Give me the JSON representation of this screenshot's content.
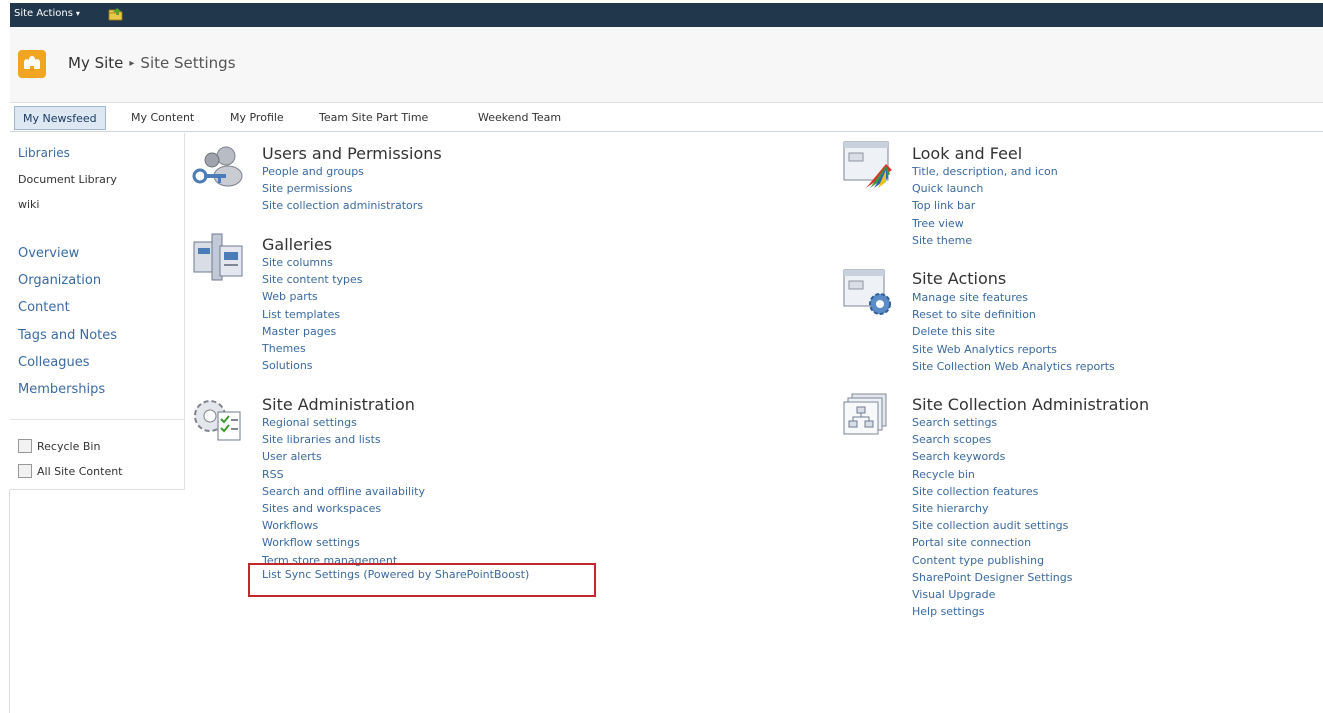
{
  "ribbon": {
    "site_actions": "Site Actions",
    "caret": "▾"
  },
  "breadcrumb": {
    "root": "My Site",
    "separator": "▸",
    "current": "Site Settings"
  },
  "topnav": {
    "tabs": [
      "My Newsfeed",
      "My Content",
      "My Profile",
      "Team Site Part Time",
      "Weekend Team"
    ]
  },
  "leftnav": {
    "libraries_heading": "Libraries",
    "libraries": [
      "Document Library",
      "wiki"
    ],
    "links": [
      "Overview",
      "Organization",
      "Content",
      "Tags and Notes",
      "Colleagues",
      "Memberships"
    ],
    "recycle_bin": "Recycle Bin",
    "all_site_content": "All Site Content"
  },
  "sections": {
    "users": {
      "title": "Users and Permissions",
      "links": [
        "People and groups",
        "Site permissions",
        "Site collection administrators"
      ]
    },
    "galleries": {
      "title": "Galleries",
      "links": [
        "Site columns",
        "Site content types",
        "Web parts",
        "List templates",
        "Master pages",
        "Themes",
        "Solutions"
      ]
    },
    "site_admin": {
      "title": "Site Administration",
      "links": [
        "Regional settings",
        "Site libraries and lists",
        "User alerts",
        "RSS",
        "Search and offline availability",
        "Sites and workspaces",
        "Workflows",
        "Workflow settings",
        "Term store management"
      ],
      "highlighted_link": "List Sync Settings (Powered by SharePointBoost)"
    },
    "look_feel": {
      "title": "Look and Feel",
      "links": [
        "Title, description, and icon",
        "Quick launch",
        "Top link bar",
        "Tree view",
        "Site theme"
      ]
    },
    "site_actions": {
      "title": "Site Actions",
      "links": [
        "Manage site features",
        "Reset to site definition",
        "Delete this site",
        "Site Web Analytics reports",
        "Site Collection Web Analytics reports"
      ]
    },
    "site_collection_admin": {
      "title": "Site Collection Administration",
      "links": [
        "Search settings",
        "Search scopes",
        "Search keywords",
        "Recycle bin",
        "Site collection features",
        "Site hierarchy",
        "Site collection audit settings",
        "Portal site connection",
        "Content type publishing",
        "SharePoint Designer Settings",
        "Visual Upgrade",
        "Help settings"
      ]
    }
  },
  "colors": {
    "ribbon": "#21374c",
    "link": "#3b6aa0",
    "highlight_border": "#c0282e",
    "logo": "#f0a420"
  },
  "icons": [
    "navigate-up-icon",
    "site-logo-icon",
    "users-permissions-icon",
    "galleries-icon",
    "site-administration-icon",
    "look-and-feel-icon",
    "site-actions-icon",
    "site-collection-admin-icon",
    "recycle-bin-icon",
    "all-site-content-icon"
  ]
}
